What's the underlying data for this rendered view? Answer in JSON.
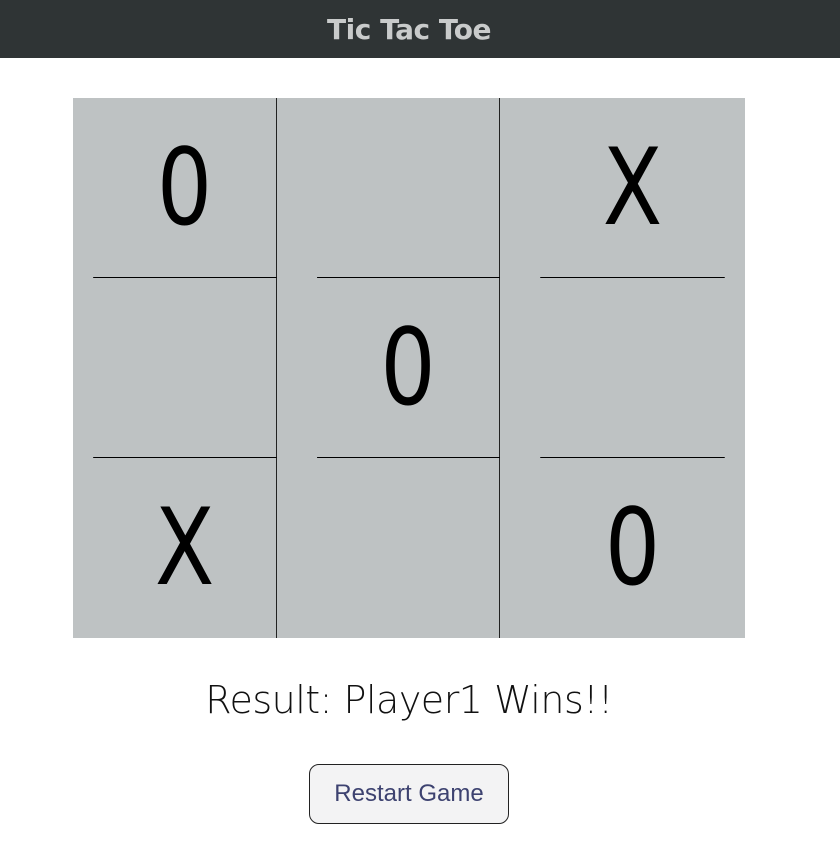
{
  "header": {
    "title": "Tic Tac Toe"
  },
  "board": {
    "cells": [
      "0",
      "",
      "X",
      "",
      "0",
      "",
      "X",
      "",
      "0"
    ]
  },
  "result": {
    "text": "Result: Player1 Wins!!"
  },
  "controls": {
    "restart_label": "Restart Game"
  },
  "colors": {
    "header_bg": "#2f3435",
    "header_text": "#c9cbcb",
    "board_bg": "#bec2c3",
    "grid_line": "#000000",
    "button_text": "#3d4270"
  }
}
